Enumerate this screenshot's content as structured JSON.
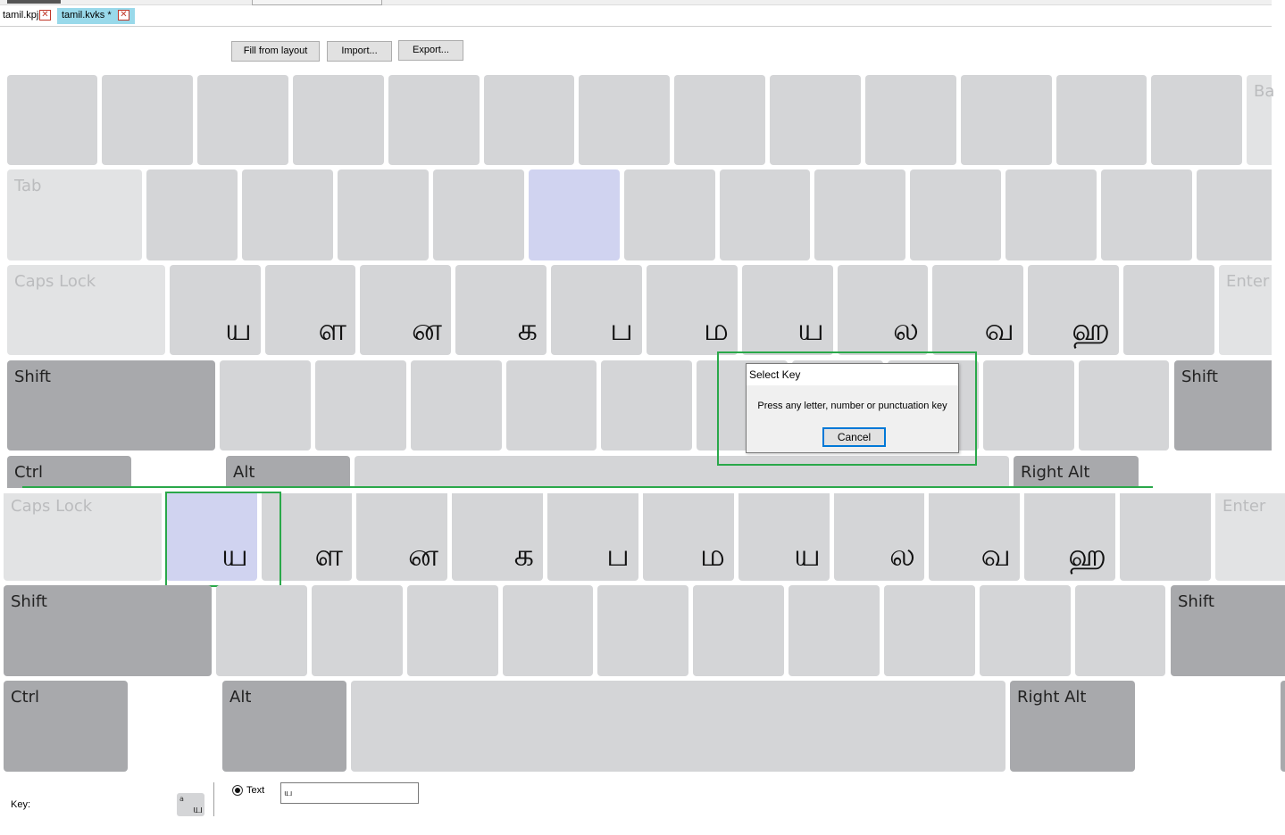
{
  "tabs": [
    {
      "label": "tamil.kpj",
      "active": false
    },
    {
      "label": "tamil.kvks *",
      "active": true
    }
  ],
  "toolbar": {
    "fill_label": "Fill from layout",
    "import_label": "Import...",
    "export_label": "Export..."
  },
  "keyboard_top": {
    "tab_label": "Tab",
    "caps_label": "Caps Lock",
    "enter_label": "Enter",
    "shift_label": "Shift",
    "ctrl_label": "Ctrl",
    "alt_label": "Alt",
    "right_alt_label": "Right Alt",
    "back_partial": "Ba",
    "home_row_chars": [
      "ய",
      "ள",
      "ன",
      "க",
      "ப",
      "ம",
      "ய",
      "ல",
      "வ",
      "ஹ"
    ]
  },
  "keyboard_bottom": {
    "caps_label": "Caps Lock",
    "enter_label": "Enter",
    "shift_label": "Shift",
    "ctrl_label": "Ctrl",
    "alt_label": "Alt",
    "right_alt_label": "Right Alt",
    "home_row_chars": [
      "ய",
      "ள",
      "ன",
      "க",
      "ப",
      "ம",
      "ய",
      "ல",
      "வ",
      "ஹ"
    ]
  },
  "dialog": {
    "title": "Select Key",
    "message": "Press any letter, number or punctuation key",
    "cancel_label": "Cancel"
  },
  "footer": {
    "key_label": "Key:",
    "preview_small": "a",
    "preview_char": "ய",
    "text_option_label": "Text",
    "text_value": "ய"
  },
  "colors": {
    "key": "#d4d5d7",
    "key_light": "#e2e3e4",
    "key_modifier": "#a8a9ac",
    "key_selected": "#d0d3f0",
    "highlight": "#2aa84a",
    "tab_active": "#99d9ea"
  }
}
